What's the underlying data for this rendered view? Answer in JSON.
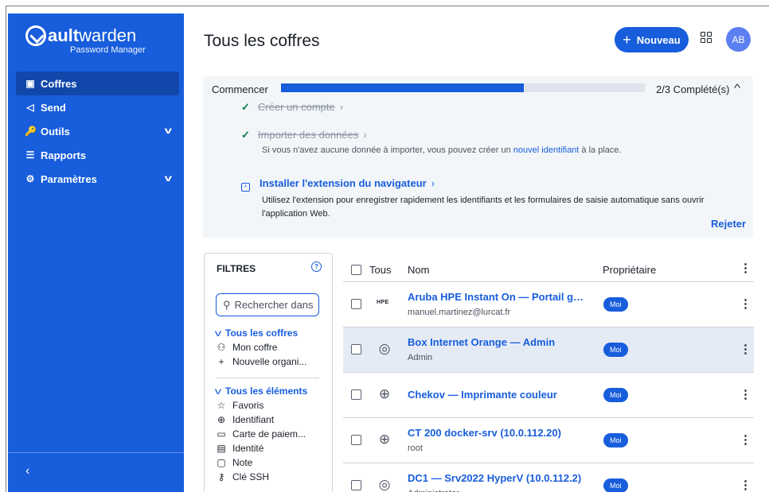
{
  "brand": {
    "name_bold": "ault",
    "name_rest": "warden",
    "subtitle": "Password Manager"
  },
  "sidebar": {
    "items": [
      {
        "label": "Coffres",
        "icon": "vault-icon",
        "glyph": "▣",
        "active": true
      },
      {
        "label": "Send",
        "icon": "send-icon",
        "glyph": "◁",
        "active": false
      },
      {
        "label": "Outils",
        "icon": "tools-icon",
        "glyph": "🔑",
        "active": false,
        "expandable": true
      },
      {
        "label": "Rapports",
        "icon": "reports-icon",
        "glyph": "☰",
        "active": false
      },
      {
        "label": "Paramètres",
        "icon": "settings-icon",
        "glyph": "⚙",
        "active": false,
        "expandable": true
      }
    ],
    "collapse_icon": "chevron-left-icon"
  },
  "header": {
    "title": "Tous les coffres",
    "new_button": "Nouveau",
    "avatar_initials": "AB"
  },
  "onboarding": {
    "title": "Commencer",
    "progress": 0.667,
    "status": "2/3 Complété(s)",
    "tasks": [
      {
        "label": "Créer un compte",
        "done": true
      },
      {
        "label": "Importer des données",
        "done": true,
        "hint_before": "Si vous n'avez aucune donnée à importer, vous pouvez créer un ",
        "hint_link": "nouvel identifiant",
        "hint_after": " à la place."
      },
      {
        "label": "Installer l'extension du navigateur",
        "done": false,
        "hint": "Utilisez l'extension pour enregistrer rapidement les identifiants et les formulaires de saisie automatique sans ouvrir l'application Web."
      }
    ],
    "dismiss": "Rejeter"
  },
  "filters": {
    "title": "FILTRES",
    "search_placeholder": "Rechercher dans",
    "vaults_title": "Tous les coffres",
    "vaults": [
      {
        "label": "Mon coffre",
        "icon": "person-icon",
        "glyph": "⚇"
      },
      {
        "label": "Nouvelle organi...",
        "icon": "plus-icon",
        "glyph": "+"
      }
    ],
    "items_title": "Tous les éléments",
    "items": [
      {
        "label": "Favoris",
        "icon": "star-icon",
        "glyph": "☆"
      },
      {
        "label": "Identifiant",
        "icon": "globe-icon",
        "glyph": "⊕"
      },
      {
        "label": "Carte de paiem...",
        "icon": "credit-card-icon",
        "glyph": "▭"
      },
      {
        "label": "Identité",
        "icon": "id-card-icon",
        "glyph": "▤"
      },
      {
        "label": "Note",
        "icon": "note-icon",
        "glyph": "▢"
      },
      {
        "label": "Clé SSH",
        "icon": "key-icon",
        "glyph": "⚷"
      }
    ]
  },
  "table": {
    "headers": {
      "all": "Tous",
      "name": "Nom",
      "owner": "Propriétaire"
    },
    "rows": [
      {
        "name": "Aruba HPE Instant On — Portail gesti...",
        "sub": "manuel.martinez@lurcat.fr",
        "owner": "Moi",
        "icon": "hpe-logo-icon",
        "icon_text": "HPE",
        "highlight": false
      },
      {
        "name": "Box Internet Orange — Admin",
        "sub": "Admin",
        "owner": "Moi",
        "icon": "favicon-placeholder-icon",
        "glyph": "◎",
        "highlight": true
      },
      {
        "name": "Chekov — Imprimante couleur",
        "sub": "",
        "owner": "Moi",
        "icon": "globe-icon",
        "glyph": "⊕",
        "highlight": false
      },
      {
        "name": "CT 200 docker-srv (10.0.112.20)",
        "sub": "root",
        "owner": "Moi",
        "icon": "globe-icon",
        "glyph": "⊕",
        "highlight": false
      },
      {
        "name": "DC1 — Srv2022 HyperV (10.0.112.2)",
        "sub": "Administrator",
        "owner": "Moi",
        "icon": "favicon-placeholder-icon",
        "glyph": "◎",
        "highlight": false
      }
    ]
  },
  "colors": {
    "primary": "#175ddc",
    "sidebar_active": "#1147ab",
    "success": "#017e45",
    "row_highlight": "#e5ebf4"
  }
}
